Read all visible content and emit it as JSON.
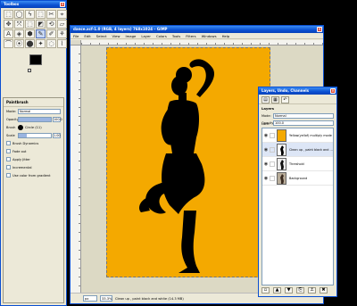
{
  "toolbox": {
    "title": "Toolbox",
    "tools": [
      "⬚",
      "◯",
      "ϟ",
      "⬚",
      "✂",
      "⌖",
      "✥",
      "⤧",
      "⬚",
      "◩",
      "⟲",
      "▱",
      "A",
      "◈",
      "⬢",
      "✎",
      "✐",
      "⚘",
      "⌒",
      "⦿",
      "⬤",
      "✦",
      "◌",
      "⌇"
    ],
    "fg_color": "#000000",
    "bg_color": "#ffffff",
    "options": {
      "title": "Paintbrush",
      "mode_label": "Mode:",
      "mode_value": "Normal",
      "opacity_label": "Opacity",
      "opacity_value": "100.0",
      "opacity_level": 1.0,
      "brush_label": "Brush",
      "brush_value": "Circle (11)",
      "scale_label": "Scale",
      "scale_value": "1.00",
      "scale_level": 0.25,
      "check_items": [
        "Brush Dynamics",
        "Fade out",
        "Apply Jitter",
        "Incremental",
        "Use color from gradient"
      ]
    }
  },
  "image_window": {
    "title": "dance.xcf-1.0 (RGB, 4 layers) 768x1024 – GIMP",
    "menu": [
      "File",
      "Edit",
      "Select",
      "View",
      "Image",
      "Layer",
      "Colors",
      "Tools",
      "Filters",
      "Windows",
      "Help"
    ],
    "canvas_color": "#f4a900",
    "status": {
      "unit": "px",
      "zoom": "33.3%",
      "message": "Clean up , paint black and white (14.3 MB)"
    }
  },
  "layers_dialog": {
    "title": "Layers, Undo, Channels",
    "tab_name": "Layers",
    "mode_label": "Mode:",
    "mode_value": "Normal",
    "opacity_label": "Opacity:",
    "opacity_value": "100.0",
    "lock_label": "Lock:",
    "layers": [
      {
        "name": "Yellow(yellof) multiply mode",
        "thumb": "yellow",
        "visible": true,
        "selected": false
      },
      {
        "name": "Clean up , paint black and white",
        "thumb": "silhouette",
        "visible": true,
        "selected": true
      },
      {
        "name": "Threshold",
        "thumb": "bw",
        "visible": true,
        "selected": false
      },
      {
        "name": "Background",
        "thumb": "photo",
        "visible": true,
        "selected": false
      }
    ],
    "buttons": [
      "▫",
      "▲",
      "▼",
      "⎘",
      "⚓",
      "✖"
    ]
  }
}
